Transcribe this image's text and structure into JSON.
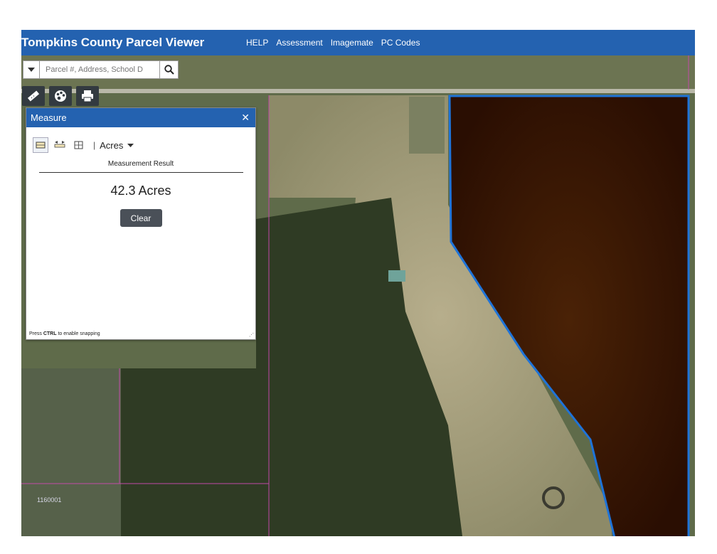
{
  "header": {
    "title": "Tompkins County Parcel Viewer",
    "links": [
      "HELP",
      "Assessment",
      "Imagemate",
      "PC Codes"
    ]
  },
  "search": {
    "placeholder": "Parcel #, Address, School D"
  },
  "toolbar": {
    "tools": [
      "measure-icon",
      "basemap-gallery-icon",
      "print-icon"
    ]
  },
  "measure_panel": {
    "title": "Measure",
    "unit": "Acres",
    "result_label": "Measurement Result",
    "result_value": "42.3 Acres",
    "clear_label": "Clear",
    "hint_prefix": "Press ",
    "hint_key": "CTRL",
    "hint_suffix": " to enable snapping"
  },
  "map": {
    "parcel_label": "1160001",
    "colors": {
      "header": "#2462b0",
      "measured_outline": "#1e73d8",
      "measured_fill": "#2a0a00",
      "parcel_lines": "#c24aa8"
    }
  }
}
